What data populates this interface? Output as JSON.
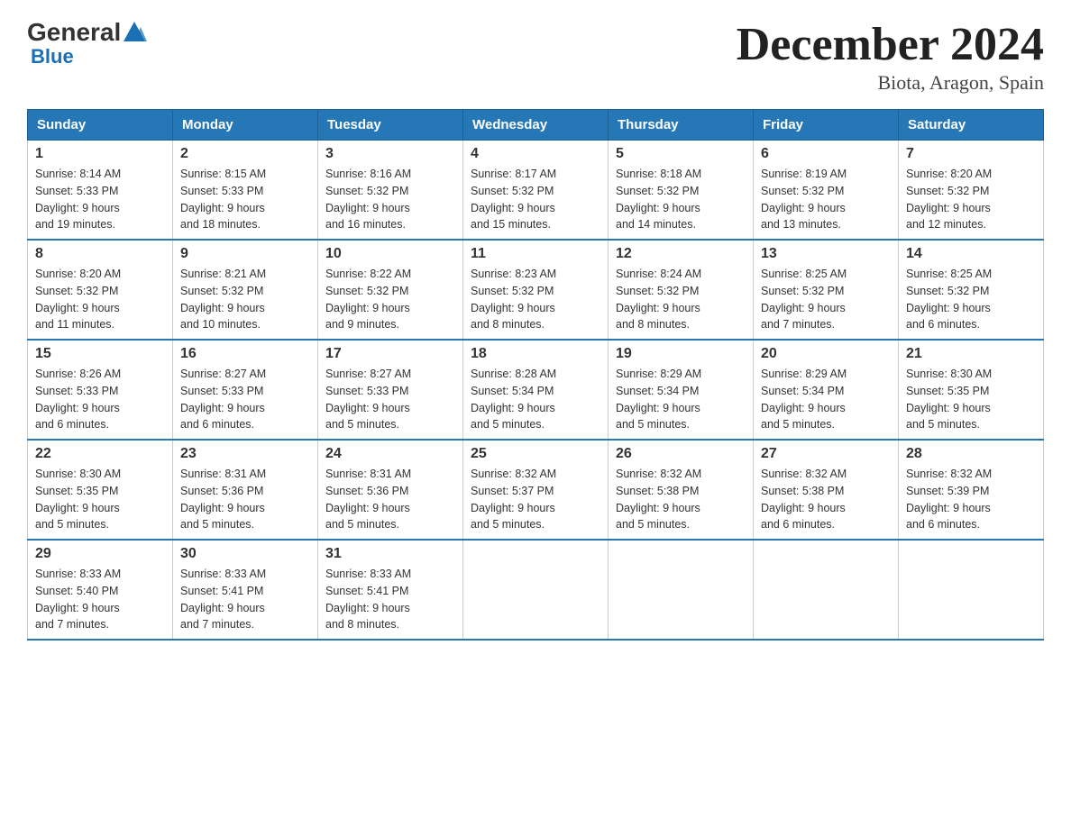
{
  "header": {
    "title": "December 2024",
    "subtitle": "Biota, Aragon, Spain"
  },
  "logo": {
    "general": "General",
    "blue": "Blue"
  },
  "days_of_week": [
    "Sunday",
    "Monday",
    "Tuesday",
    "Wednesday",
    "Thursday",
    "Friday",
    "Saturday"
  ],
  "weeks": [
    [
      {
        "day": "1",
        "sunrise": "8:14 AM",
        "sunset": "5:33 PM",
        "daylight": "9 hours and 19 minutes."
      },
      {
        "day": "2",
        "sunrise": "8:15 AM",
        "sunset": "5:33 PM",
        "daylight": "9 hours and 18 minutes."
      },
      {
        "day": "3",
        "sunrise": "8:16 AM",
        "sunset": "5:32 PM",
        "daylight": "9 hours and 16 minutes."
      },
      {
        "day": "4",
        "sunrise": "8:17 AM",
        "sunset": "5:32 PM",
        "daylight": "9 hours and 15 minutes."
      },
      {
        "day": "5",
        "sunrise": "8:18 AM",
        "sunset": "5:32 PM",
        "daylight": "9 hours and 14 minutes."
      },
      {
        "day": "6",
        "sunrise": "8:19 AM",
        "sunset": "5:32 PM",
        "daylight": "9 hours and 13 minutes."
      },
      {
        "day": "7",
        "sunrise": "8:20 AM",
        "sunset": "5:32 PM",
        "daylight": "9 hours and 12 minutes."
      }
    ],
    [
      {
        "day": "8",
        "sunrise": "8:20 AM",
        "sunset": "5:32 PM",
        "daylight": "9 hours and 11 minutes."
      },
      {
        "day": "9",
        "sunrise": "8:21 AM",
        "sunset": "5:32 PM",
        "daylight": "9 hours and 10 minutes."
      },
      {
        "day": "10",
        "sunrise": "8:22 AM",
        "sunset": "5:32 PM",
        "daylight": "9 hours and 9 minutes."
      },
      {
        "day": "11",
        "sunrise": "8:23 AM",
        "sunset": "5:32 PM",
        "daylight": "9 hours and 8 minutes."
      },
      {
        "day": "12",
        "sunrise": "8:24 AM",
        "sunset": "5:32 PM",
        "daylight": "9 hours and 8 minutes."
      },
      {
        "day": "13",
        "sunrise": "8:25 AM",
        "sunset": "5:32 PM",
        "daylight": "9 hours and 7 minutes."
      },
      {
        "day": "14",
        "sunrise": "8:25 AM",
        "sunset": "5:32 PM",
        "daylight": "9 hours and 6 minutes."
      }
    ],
    [
      {
        "day": "15",
        "sunrise": "8:26 AM",
        "sunset": "5:33 PM",
        "daylight": "9 hours and 6 minutes."
      },
      {
        "day": "16",
        "sunrise": "8:27 AM",
        "sunset": "5:33 PM",
        "daylight": "9 hours and 6 minutes."
      },
      {
        "day": "17",
        "sunrise": "8:27 AM",
        "sunset": "5:33 PM",
        "daylight": "9 hours and 5 minutes."
      },
      {
        "day": "18",
        "sunrise": "8:28 AM",
        "sunset": "5:34 PM",
        "daylight": "9 hours and 5 minutes."
      },
      {
        "day": "19",
        "sunrise": "8:29 AM",
        "sunset": "5:34 PM",
        "daylight": "9 hours and 5 minutes."
      },
      {
        "day": "20",
        "sunrise": "8:29 AM",
        "sunset": "5:34 PM",
        "daylight": "9 hours and 5 minutes."
      },
      {
        "day": "21",
        "sunrise": "8:30 AM",
        "sunset": "5:35 PM",
        "daylight": "9 hours and 5 minutes."
      }
    ],
    [
      {
        "day": "22",
        "sunrise": "8:30 AM",
        "sunset": "5:35 PM",
        "daylight": "9 hours and 5 minutes."
      },
      {
        "day": "23",
        "sunrise": "8:31 AM",
        "sunset": "5:36 PM",
        "daylight": "9 hours and 5 minutes."
      },
      {
        "day": "24",
        "sunrise": "8:31 AM",
        "sunset": "5:36 PM",
        "daylight": "9 hours and 5 minutes."
      },
      {
        "day": "25",
        "sunrise": "8:32 AM",
        "sunset": "5:37 PM",
        "daylight": "9 hours and 5 minutes."
      },
      {
        "day": "26",
        "sunrise": "8:32 AM",
        "sunset": "5:38 PM",
        "daylight": "9 hours and 5 minutes."
      },
      {
        "day": "27",
        "sunrise": "8:32 AM",
        "sunset": "5:38 PM",
        "daylight": "9 hours and 6 minutes."
      },
      {
        "day": "28",
        "sunrise": "8:32 AM",
        "sunset": "5:39 PM",
        "daylight": "9 hours and 6 minutes."
      }
    ],
    [
      {
        "day": "29",
        "sunrise": "8:33 AM",
        "sunset": "5:40 PM",
        "daylight": "9 hours and 7 minutes."
      },
      {
        "day": "30",
        "sunrise": "8:33 AM",
        "sunset": "5:41 PM",
        "daylight": "9 hours and 7 minutes."
      },
      {
        "day": "31",
        "sunrise": "8:33 AM",
        "sunset": "5:41 PM",
        "daylight": "9 hours and 8 minutes."
      },
      null,
      null,
      null,
      null
    ]
  ]
}
